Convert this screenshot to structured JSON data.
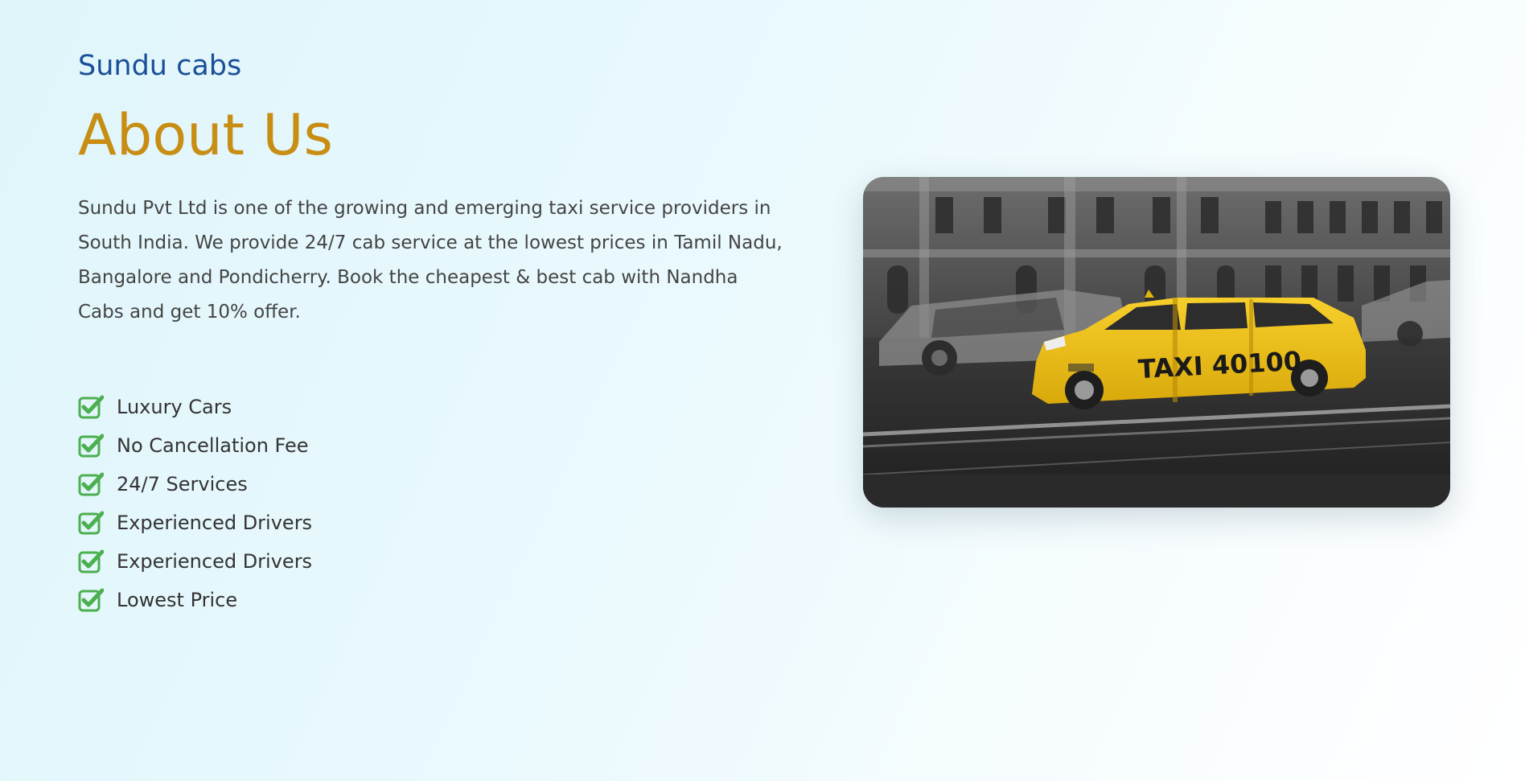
{
  "brand": "Sundu cabs",
  "about": {
    "title": "About Us",
    "description": "Sundu Pvt Ltd is one of the growing and emerging taxi service providers in South India. We provide 24/7 cab service at the lowest prices in Tamil Nadu, Bangalore and Pondicherry. Book the cheapest & best cab with Nandha Cabs and get 10% offer."
  },
  "features": [
    {
      "label": "Luxury Cars"
    },
    {
      "label": "No Cancellation Fee"
    },
    {
      "label": "24/7 Services"
    },
    {
      "label": "Experienced Drivers"
    },
    {
      "label": "Experienced Drivers"
    },
    {
      "label": "Lowest Price"
    }
  ],
  "photo": {
    "taxi_text": "TAXI 40100",
    "icon": "taxi-photo"
  },
  "colors": {
    "brand": "#1a4f98",
    "title": "#c88d13",
    "check": "#4caf50",
    "taxi": "#f5c518"
  }
}
